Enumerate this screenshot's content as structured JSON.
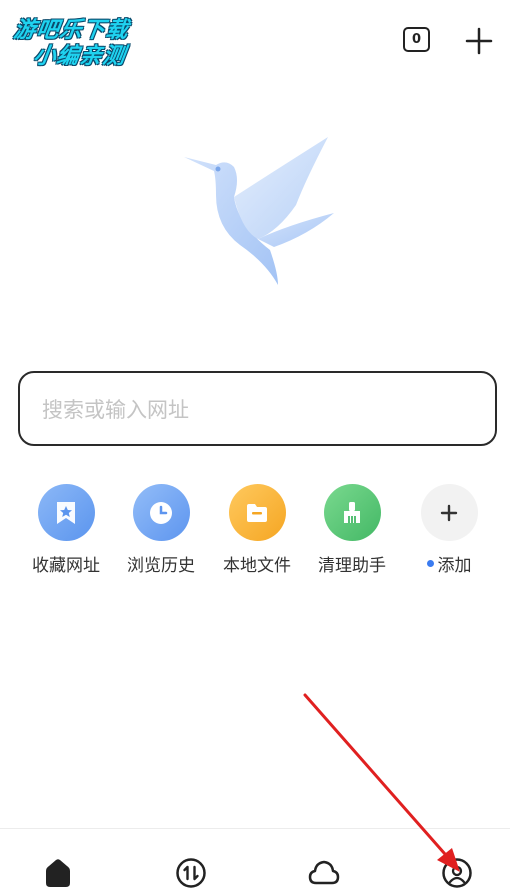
{
  "watermark": {
    "line1": "游吧乐下载",
    "line2": "小编亲测"
  },
  "header": {
    "tab_count": "0",
    "add_icon": "plus-icon"
  },
  "logo": {
    "icon": "hummingbird-logo"
  },
  "search": {
    "placeholder": "搜索或输入网址"
  },
  "shortcuts": [
    {
      "label": "收藏网址",
      "icon": "bookmark-star-icon",
      "color": "#5b9bf0"
    },
    {
      "label": "浏览历史",
      "icon": "clock-icon",
      "color": "#5b9bf0"
    },
    {
      "label": "本地文件",
      "icon": "folder-icon",
      "color": "#f5a623"
    },
    {
      "label": "清理助手",
      "icon": "broom-icon",
      "color": "#4cc070"
    },
    {
      "label": "添加",
      "icon": "plus-icon",
      "color": "#f2f2f2"
    }
  ],
  "bottom_nav": [
    {
      "icon": "home-icon"
    },
    {
      "icon": "transfer-icon"
    },
    {
      "icon": "cloud-icon"
    },
    {
      "icon": "profile-icon"
    }
  ],
  "annotation": {
    "color": "#e02020"
  }
}
